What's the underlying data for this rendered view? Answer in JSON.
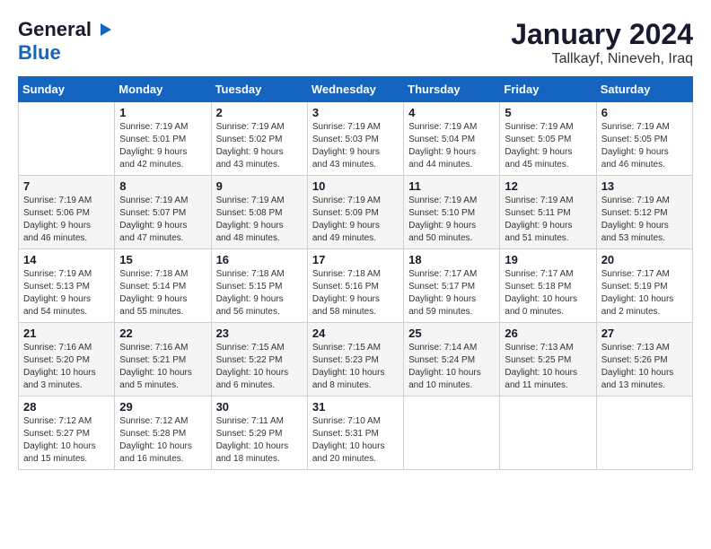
{
  "header": {
    "logo_line1": "General",
    "logo_line2": "Blue",
    "month_year": "January 2024",
    "location": "Tallkayf, Nineveh, Iraq"
  },
  "weekdays": [
    "Sunday",
    "Monday",
    "Tuesday",
    "Wednesday",
    "Thursday",
    "Friday",
    "Saturday"
  ],
  "weeks": [
    [
      {
        "day": "",
        "info": ""
      },
      {
        "day": "1",
        "info": "Sunrise: 7:19 AM\nSunset: 5:01 PM\nDaylight: 9 hours\nand 42 minutes."
      },
      {
        "day": "2",
        "info": "Sunrise: 7:19 AM\nSunset: 5:02 PM\nDaylight: 9 hours\nand 43 minutes."
      },
      {
        "day": "3",
        "info": "Sunrise: 7:19 AM\nSunset: 5:03 PM\nDaylight: 9 hours\nand 43 minutes."
      },
      {
        "day": "4",
        "info": "Sunrise: 7:19 AM\nSunset: 5:04 PM\nDaylight: 9 hours\nand 44 minutes."
      },
      {
        "day": "5",
        "info": "Sunrise: 7:19 AM\nSunset: 5:05 PM\nDaylight: 9 hours\nand 45 minutes."
      },
      {
        "day": "6",
        "info": "Sunrise: 7:19 AM\nSunset: 5:05 PM\nDaylight: 9 hours\nand 46 minutes."
      }
    ],
    [
      {
        "day": "7",
        "info": "Sunrise: 7:19 AM\nSunset: 5:06 PM\nDaylight: 9 hours\nand 46 minutes."
      },
      {
        "day": "8",
        "info": "Sunrise: 7:19 AM\nSunset: 5:07 PM\nDaylight: 9 hours\nand 47 minutes."
      },
      {
        "day": "9",
        "info": "Sunrise: 7:19 AM\nSunset: 5:08 PM\nDaylight: 9 hours\nand 48 minutes."
      },
      {
        "day": "10",
        "info": "Sunrise: 7:19 AM\nSunset: 5:09 PM\nDaylight: 9 hours\nand 49 minutes."
      },
      {
        "day": "11",
        "info": "Sunrise: 7:19 AM\nSunset: 5:10 PM\nDaylight: 9 hours\nand 50 minutes."
      },
      {
        "day": "12",
        "info": "Sunrise: 7:19 AM\nSunset: 5:11 PM\nDaylight: 9 hours\nand 51 minutes."
      },
      {
        "day": "13",
        "info": "Sunrise: 7:19 AM\nSunset: 5:12 PM\nDaylight: 9 hours\nand 53 minutes."
      }
    ],
    [
      {
        "day": "14",
        "info": "Sunrise: 7:19 AM\nSunset: 5:13 PM\nDaylight: 9 hours\nand 54 minutes."
      },
      {
        "day": "15",
        "info": "Sunrise: 7:18 AM\nSunset: 5:14 PM\nDaylight: 9 hours\nand 55 minutes."
      },
      {
        "day": "16",
        "info": "Sunrise: 7:18 AM\nSunset: 5:15 PM\nDaylight: 9 hours\nand 56 minutes."
      },
      {
        "day": "17",
        "info": "Sunrise: 7:18 AM\nSunset: 5:16 PM\nDaylight: 9 hours\nand 58 minutes."
      },
      {
        "day": "18",
        "info": "Sunrise: 7:17 AM\nSunset: 5:17 PM\nDaylight: 9 hours\nand 59 minutes."
      },
      {
        "day": "19",
        "info": "Sunrise: 7:17 AM\nSunset: 5:18 PM\nDaylight: 10 hours\nand 0 minutes."
      },
      {
        "day": "20",
        "info": "Sunrise: 7:17 AM\nSunset: 5:19 PM\nDaylight: 10 hours\nand 2 minutes."
      }
    ],
    [
      {
        "day": "21",
        "info": "Sunrise: 7:16 AM\nSunset: 5:20 PM\nDaylight: 10 hours\nand 3 minutes."
      },
      {
        "day": "22",
        "info": "Sunrise: 7:16 AM\nSunset: 5:21 PM\nDaylight: 10 hours\nand 5 minutes."
      },
      {
        "day": "23",
        "info": "Sunrise: 7:15 AM\nSunset: 5:22 PM\nDaylight: 10 hours\nand 6 minutes."
      },
      {
        "day": "24",
        "info": "Sunrise: 7:15 AM\nSunset: 5:23 PM\nDaylight: 10 hours\nand 8 minutes."
      },
      {
        "day": "25",
        "info": "Sunrise: 7:14 AM\nSunset: 5:24 PM\nDaylight: 10 hours\nand 10 minutes."
      },
      {
        "day": "26",
        "info": "Sunrise: 7:13 AM\nSunset: 5:25 PM\nDaylight: 10 hours\nand 11 minutes."
      },
      {
        "day": "27",
        "info": "Sunrise: 7:13 AM\nSunset: 5:26 PM\nDaylight: 10 hours\nand 13 minutes."
      }
    ],
    [
      {
        "day": "28",
        "info": "Sunrise: 7:12 AM\nSunset: 5:27 PM\nDaylight: 10 hours\nand 15 minutes."
      },
      {
        "day": "29",
        "info": "Sunrise: 7:12 AM\nSunset: 5:28 PM\nDaylight: 10 hours\nand 16 minutes."
      },
      {
        "day": "30",
        "info": "Sunrise: 7:11 AM\nSunset: 5:29 PM\nDaylight: 10 hours\nand 18 minutes."
      },
      {
        "day": "31",
        "info": "Sunrise: 7:10 AM\nSunset: 5:31 PM\nDaylight: 10 hours\nand 20 minutes."
      },
      {
        "day": "",
        "info": ""
      },
      {
        "day": "",
        "info": ""
      },
      {
        "day": "",
        "info": ""
      }
    ]
  ]
}
